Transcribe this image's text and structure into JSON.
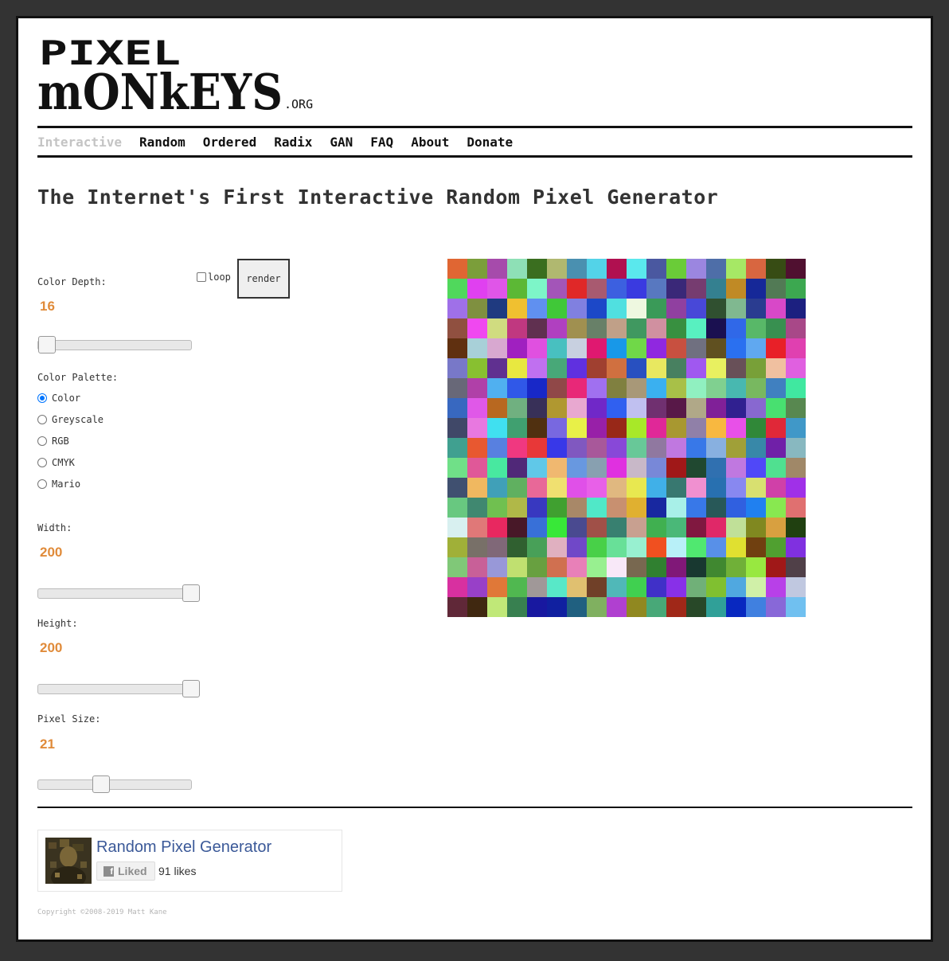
{
  "logo": {
    "line1": "PIXEL",
    "line2": "mONkEYS",
    "suffix": ".ORG"
  },
  "nav": [
    {
      "label": "Interactive",
      "active": true
    },
    {
      "label": "Random"
    },
    {
      "label": "Ordered"
    },
    {
      "label": "Radix"
    },
    {
      "label": "GAN"
    },
    {
      "label": "FAQ"
    },
    {
      "label": "About"
    },
    {
      "label": "Donate"
    }
  ],
  "page_title": "The Internet's First Interactive Random Pixel Generator",
  "controls": {
    "color_depth": {
      "label": "Color Depth:",
      "value": "16"
    },
    "palette": {
      "label": "Color Palette:",
      "options": [
        "Color",
        "Greyscale",
        "RGB",
        "CMYK",
        "Mario"
      ],
      "selected": "Color"
    },
    "width": {
      "label": "Width:",
      "value": "200"
    },
    "height": {
      "label": "Height:",
      "value": "200"
    },
    "pixel_size": {
      "label": "Pixel Size:",
      "value": "21"
    },
    "loop_label": "loop",
    "render_label": "render"
  },
  "pixel_canvas": {
    "grid": 18,
    "colors": [
      "#e06633",
      "#7b9e3a",
      "#a64bab",
      "#8ee0b6",
      "#3a6e1f",
      "#b0b870",
      "#4a90b0",
      "#53d3e8",
      "#b01050",
      "#5ae8ed",
      "#4a58a0",
      "#6acc38",
      "#9b86e0",
      "#4e6ea8",
      "#a6e865",
      "#d86640",
      "#374c14",
      "#501030",
      "#50d85c",
      "#e040f0",
      "#e055e8",
      "#5cb835",
      "#7df5c8",
      "#a355b8",
      "#e02828",
      "#a85a70",
      "#3c60e0",
      "#3a3ae0",
      "#5878c0",
      "#3a2878",
      "#763c70",
      "#348090",
      "#c08a25",
      "#162898",
      "#527a55",
      "#3ca850",
      "#9f70e8",
      "#7f9040",
      "#1f3a80",
      "#f0c030",
      "#6090f0",
      "#40c838",
      "#8080e0",
      "#1c48c8",
      "#50e0e0",
      "#eef8e0",
      "#3a9a58",
      "#9040a0",
      "#4848d8",
      "#305030",
      "#80b890",
      "#2a3c90",
      "#d848c8",
      "#1c2080",
      "#905040",
      "#f048f0",
      "#d0dc80",
      "#c03880",
      "#603050",
      "#b040c0",
      "#a09050",
      "#688068",
      "#c0a088",
      "#409860",
      "#d090a0",
      "#389040",
      "#58f0c0",
      "#1a1050",
      "#3068e8",
      "#58b868",
      "#389050",
      "#a84888",
      "#603010",
      "#a8d0d8",
      "#d8a8d0",
      "#a020c0",
      "#e050e0",
      "#48c0c0",
      "#c8d0e0",
      "#e01870",
      "#1898e8",
      "#70d848",
      "#9028e0",
      "#c85040",
      "#707080",
      "#605020",
      "#2a70f0",
      "#60a8f0",
      "#e82028",
      "#e040b0",
      "#7878c8",
      "#88c030",
      "#603090",
      "#e8e840",
      "#c070f0",
      "#48a878",
      "#6030e0",
      "#a04030",
      "#d07040",
      "#2850c0",
      "#e8e860",
      "#488060",
      "#a058f0",
      "#e8f060",
      "#685058",
      "#78a038",
      "#f0c0a0",
      "#e060e0",
      "#686878",
      "#b040a8",
      "#50b0f0",
      "#3058e8",
      "#1828c8",
      "#904848",
      "#e82878",
      "#a070f0",
      "#808040",
      "#a89878",
      "#3ab0f0",
      "#a8c048",
      "#90f0c0",
      "#80d090",
      "#48b8b0",
      "#78b860",
      "#4080c0",
      "#40e8a0",
      "#3868c0",
      "#e058e8",
      "#b86820",
      "#70b080",
      "#383058",
      "#b09830",
      "#e8a8d0",
      "#7028c8",
      "#3060f0",
      "#c0c0f0",
      "#703070",
      "#581848",
      "#b0a888",
      "#802098",
      "#302090",
      "#8868d0",
      "#48e070",
      "#588850",
      "#404868",
      "#e878e0",
      "#40e0f0",
      "#40a070",
      "#503010",
      "#7868e0",
      "#e8f048",
      "#9820a8",
      "#982818",
      "#a8e828",
      "#e02898",
      "#a89830",
      "#9080a8",
      "#f8b840",
      "#e850e8",
      "#308838",
      "#e02838",
      "#4098c8",
      "#40a090",
      "#e85830",
      "#5880e0",
      "#f03880",
      "#e83838",
      "#3838e8",
      "#8058c0",
      "#a8589a",
      "#8848d8",
      "#68c898",
      "#9078a0",
      "#c078e0",
      "#3878e8",
      "#88b0e0",
      "#a0a038",
      "#3888a8",
      "#7020a8",
      "#88b8c0",
      "#70e088",
      "#e05898",
      "#48e8a0",
      "#502878",
      "#60c8e8",
      "#f0b870",
      "#6898e0",
      "#88a0b0",
      "#e030e0",
      "#c8b8c8",
      "#7888d8",
      "#a01818",
      "#204830",
      "#3070b0",
      "#c078e0",
      "#5048f8",
      "#50e090",
      "#a08868",
      "#405070",
      "#f0b860",
      "#40a0b8",
      "#60b060",
      "#e86898",
      "#f0e070",
      "#e050e8",
      "#e860e8",
      "#e0b880",
      "#e8e850",
      "#40b0e8",
      "#387870",
      "#f090d0",
      "#2870b0",
      "#8888f0",
      "#d8e070",
      "#d040a8",
      "#a030e8",
      "#68c880",
      "#408870",
      "#70c050",
      "#b0b848",
      "#3838c0",
      "#40a030",
      "#a88868",
      "#50e8c8",
      "#c89070",
      "#e0b030",
      "#1828a0",
      "#a8f0e8",
      "#3878e8",
      "#285858",
      "#3060e0",
      "#2080f0",
      "#88e850",
      "#e07070",
      "#d8f0f0",
      "#e07878",
      "#e82860",
      "#481828",
      "#3870d8",
      "#38e838",
      "#4a4a90",
      "#a05048",
      "#388070",
      "#c8a090",
      "#40b050",
      "#4ab878",
      "#801840",
      "#e02868",
      "#c0e098",
      "#808820",
      "#d8a040",
      "#204010",
      "#a0b038",
      "#787068",
      "#806878",
      "#306030",
      "#48a058",
      "#e0b0c0",
      "#7048c8",
      "#48d048",
      "#68e098",
      "#98f0d0",
      "#f05020",
      "#b8f0f8",
      "#50e870",
      "#5890e8",
      "#e0e030",
      "#704010",
      "#50a030",
      "#8030e0",
      "#80c878",
      "#c86098",
      "#9898d8",
      "#c0e070",
      "#68a040",
      "#d07050",
      "#e880b8",
      "#98f090",
      "#f8e8f8",
      "#786850",
      "#308030",
      "#801878",
      "#183830",
      "#408830",
      "#70b038",
      "#98e840",
      "#a01818",
      "#504048",
      "#d830a0",
      "#9840c8",
      "#e07838",
      "#50b850",
      "#a09898",
      "#58e8c8",
      "#e0c070",
      "#704028",
      "#50b8b8",
      "#40d050",
      "#4030c8",
      "#8830e8",
      "#70b078",
      "#80c030",
      "#50a8e0",
      "#d0f0a8",
      "#b840e8",
      "#c0c8e0",
      "#602838",
      "#402810",
      "#c0e878",
      "#388050",
      "#1818a0",
      "#1020a0",
      "#206080",
      "#80b060",
      "#b040d0",
      "#908820",
      "#48a878",
      "#a02818",
      "#284828",
      "#30a098",
      "#0828c0",
      "#4080e0",
      "#8868d8",
      "#70c0f0"
    ]
  },
  "facebook": {
    "page_name": "Random Pixel Generator",
    "liked_label": "Liked",
    "likes_text": "91 likes"
  },
  "copyright": "Copyright ©2008-2019 Matt Kane"
}
